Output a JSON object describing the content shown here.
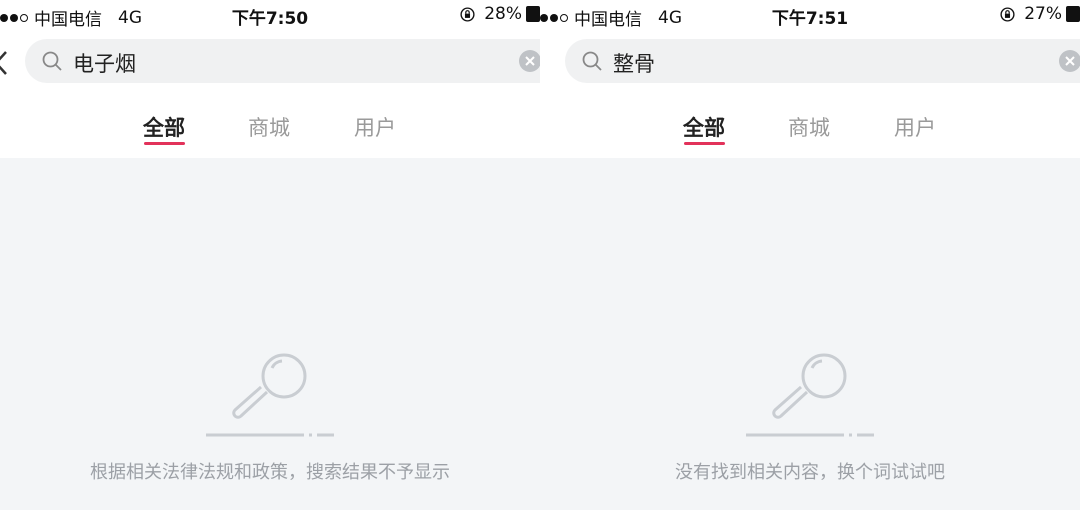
{
  "screens": [
    {
      "status": {
        "carrier": "中国电信",
        "network": "4G",
        "time": "下午7:50",
        "battery": "28%"
      },
      "search": {
        "query": "电子烟"
      },
      "tabs": [
        {
          "label": "全部",
          "active": true
        },
        {
          "label": "商城"
        },
        {
          "label": "用户"
        }
      ],
      "empty_message": "根据相关法律法规和政策，搜索结果不予显示"
    },
    {
      "status": {
        "carrier": "中国电信",
        "network": "4G",
        "time": "下午7:51",
        "battery": "27%"
      },
      "search": {
        "query": "整骨"
      },
      "tabs": [
        {
          "label": "全部",
          "active": true
        },
        {
          "label": "商城"
        },
        {
          "label": "用户"
        }
      ],
      "empty_message": "没有找到相关内容，换个词试试吧"
    }
  ],
  "colors": {
    "accent": "#e2325a",
    "background": "#f3f5f7",
    "muted_text": "#9ca0a6"
  }
}
